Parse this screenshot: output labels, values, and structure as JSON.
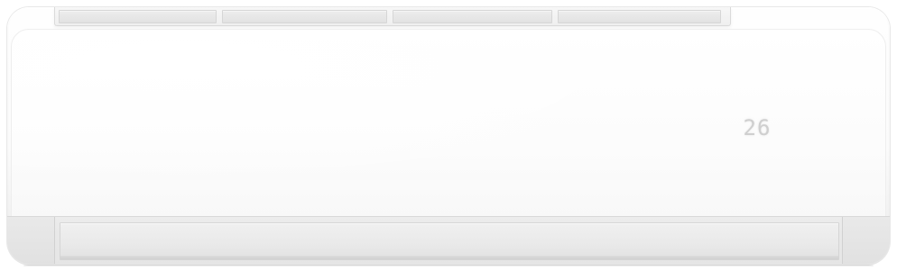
{
  "device": {
    "display": {
      "temperature": "26"
    },
    "colors": {
      "body": "#fbfbfb",
      "panel": "#ffffff",
      "grille": "#ececec",
      "louver": "#e9e9e9",
      "display": "#cfcfcf"
    }
  }
}
